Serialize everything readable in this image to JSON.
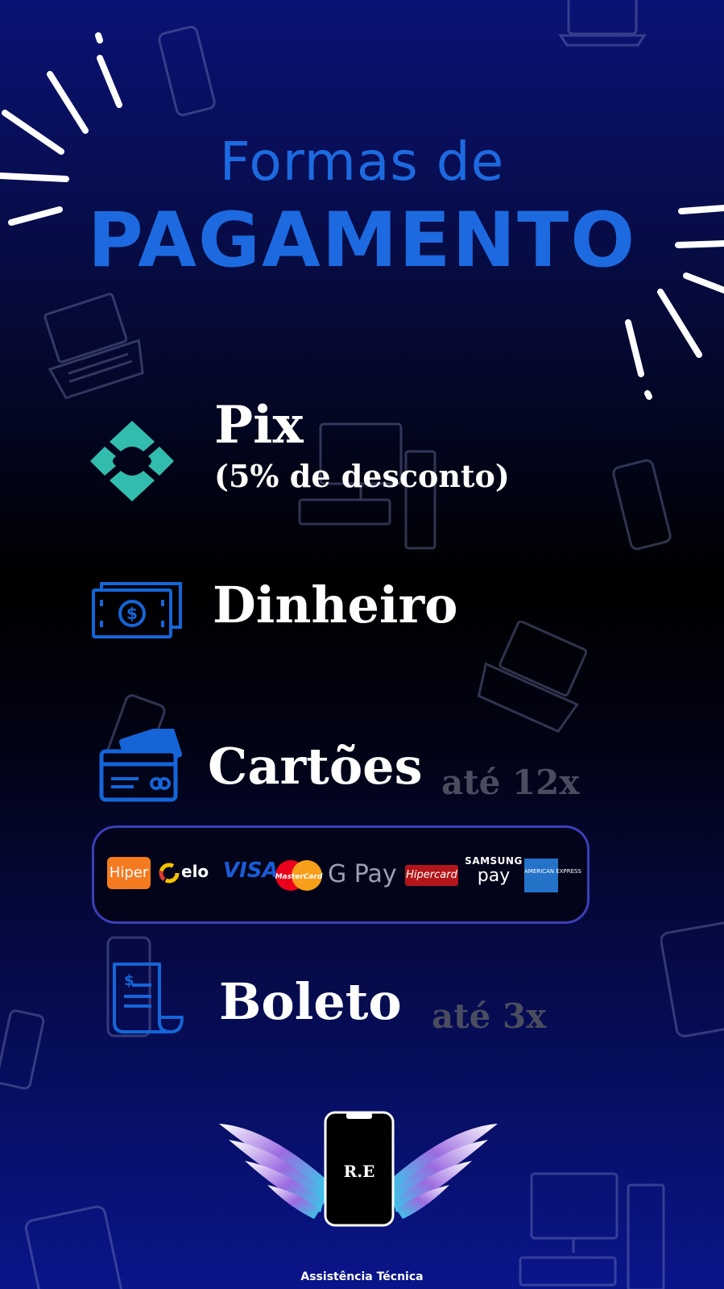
{
  "title": {
    "line1": "Formas de",
    "line2": "PAGAMENTO"
  },
  "colors": {
    "title_blue": "#1d6ae0",
    "pix_teal": "#32bcad",
    "icon_blue": "#1565d8",
    "muted_grey": "#4a4d5f"
  },
  "payments": [
    {
      "label": "Pix",
      "note": "(5% de desconto)",
      "icon": "pix-icon"
    },
    {
      "label": "Dinheiro",
      "icon": "cash-icon"
    },
    {
      "label": "Cartões",
      "installments": "até 12x",
      "icon": "credit-card-icon"
    },
    {
      "label": "Boleto",
      "installments": "até 3x",
      "icon": "boleto-icon"
    }
  ],
  "card_brands": {
    "hiper": "Hiper",
    "elo": "elo",
    "visa": "VISA",
    "mastercard": "MasterCard",
    "gpay": "G Pay",
    "hipercard": "Hipercard",
    "samsung_top": "SAMSUNG",
    "samsung_bottom": "pay",
    "amex": "AMERICAN EXPRESS"
  },
  "logo": {
    "monogram": "R.E",
    "caption": "Assistência Técnica"
  }
}
